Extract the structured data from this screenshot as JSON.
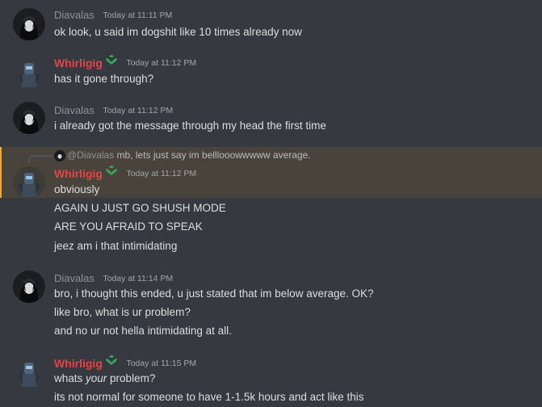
{
  "colors": {
    "background": "#36393f",
    "diavalas": "#8e9297",
    "whirligig": "#e04646",
    "badge": "#3ba55d",
    "mention_bar": "#faa61a"
  },
  "messages": [
    {
      "author": "Diavalas",
      "time": "Today at 11:11 PM",
      "lines": [
        "ok look, u said im dogshit like 10 times already now"
      ]
    },
    {
      "author": "Whirligig",
      "time": "Today at 11:12 PM",
      "lines": [
        "has it gone through?"
      ]
    },
    {
      "author": "Diavalas",
      "time": "Today at 11:12 PM",
      "lines": [
        "i already got the message through my head the first time"
      ]
    },
    {
      "author": "Whirligig",
      "time": "Today at 11:12 PM",
      "reply": {
        "mention": "@Diavalas",
        "text": " mb, lets just say im belllooowwwww average."
      },
      "lines": [
        "obviously",
        "AGAIN U JUST GO SHUSH MODE",
        "ARE YOU AFRAID TO SPEAK",
        "jeez am i that intimidating"
      ]
    },
    {
      "author": "Diavalas",
      "time": "Today at 11:14 PM",
      "lines": [
        "bro, i thought this ended, u just stated that im below average. OK?",
        "like bro, what is ur problem?",
        "and no ur not hella intimidating at all."
      ]
    },
    {
      "author": "Whirligig",
      "time": "Today at 11:15 PM",
      "lines_rich": {
        "pre": "whats ",
        "emph": "your",
        "post": " problem?"
      },
      "lines": [
        "its not normal for someone to have 1-1.5k hours and act like this"
      ]
    }
  ]
}
